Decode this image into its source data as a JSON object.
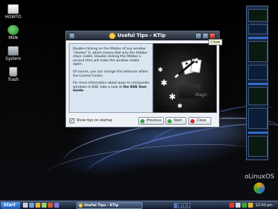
{
  "desktop": {
    "icons": [
      {
        "label": "HOWTO"
      },
      {
        "label": "MSN"
      },
      {
        "label": "System"
      },
      {
        "label": "Trash"
      }
    ],
    "branding": "oLinuxOS"
  },
  "dialog": {
    "title": "Useful Tips - KTip",
    "tooltip": "Close",
    "tip": {
      "paragraph1": "Double-clicking on the titlebar of any window \"shades\" it, which means that only the titlebar stays visible. Double-clicking the titlebar a second time will make the window visible again.",
      "paragraph2": "Of course, you can change this behavior within the Control Center.",
      "paragraph3": "For more information about ways to manipulate windows in KDE, take a look at",
      "guide_link": "the KDE User Guide",
      "guide_suffix": "."
    },
    "watermark": "Magic",
    "show_on_startup": {
      "label": "Show tips on startup",
      "checked": true
    },
    "buttons": {
      "previous": "Previous",
      "next": "Next",
      "close": "Close"
    }
  },
  "taskbar": {
    "start_label": "Start",
    "task_label": "Useful Tips - KTip",
    "clock": "12:43 pm"
  },
  "colors": {
    "titlebar": "#2a3342",
    "tip_panel": "#d9e6f2",
    "start_button": "#2f7fe0",
    "close_button": "#cc2a1c"
  }
}
